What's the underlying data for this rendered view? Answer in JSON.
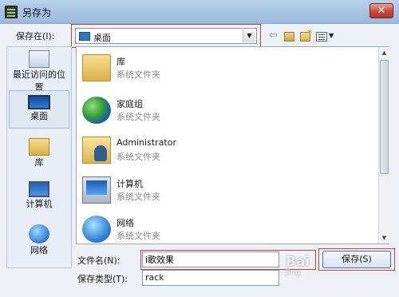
{
  "window": {
    "title": "另存为",
    "close_label": "✕"
  },
  "toolbar": {
    "save_in_label": "保存在(I):",
    "save_in_value": "桌面",
    "back_glyph": "⇦",
    "views_arrow": "▼"
  },
  "places": [
    {
      "label": "最近访问的位置",
      "icon": "recent-places-icon"
    },
    {
      "label": "桌面",
      "icon": "desktop-icon",
      "selected": true
    },
    {
      "label": "库",
      "icon": "library-icon"
    },
    {
      "label": "计算机",
      "icon": "computer-icon"
    },
    {
      "label": "网络",
      "icon": "network-icon"
    }
  ],
  "files": [
    {
      "name": "库",
      "type": "系统文件夹",
      "icon": "library-icon"
    },
    {
      "name": "家庭组",
      "type": "系统文件夹",
      "icon": "homegroup-icon"
    },
    {
      "name": "Administrator",
      "type": "系统文件夹",
      "icon": "user-folder-icon"
    },
    {
      "name": "计算机",
      "type": "系统文件夹",
      "icon": "computer-icon"
    },
    {
      "name": "网络",
      "type": "系统文件夹",
      "icon": "network-icon"
    }
  ],
  "form": {
    "filename_label": "文件名(N):",
    "filename_value": "i歌效果",
    "filetype_label": "保存类型(T):",
    "filetype_value": "rack",
    "save_button": "保存(S)"
  },
  "watermark": {
    "text": "Bai",
    "sub": "jing"
  },
  "colors": {
    "highlight": "#c44545",
    "titlebar": "#a9c4e2"
  }
}
